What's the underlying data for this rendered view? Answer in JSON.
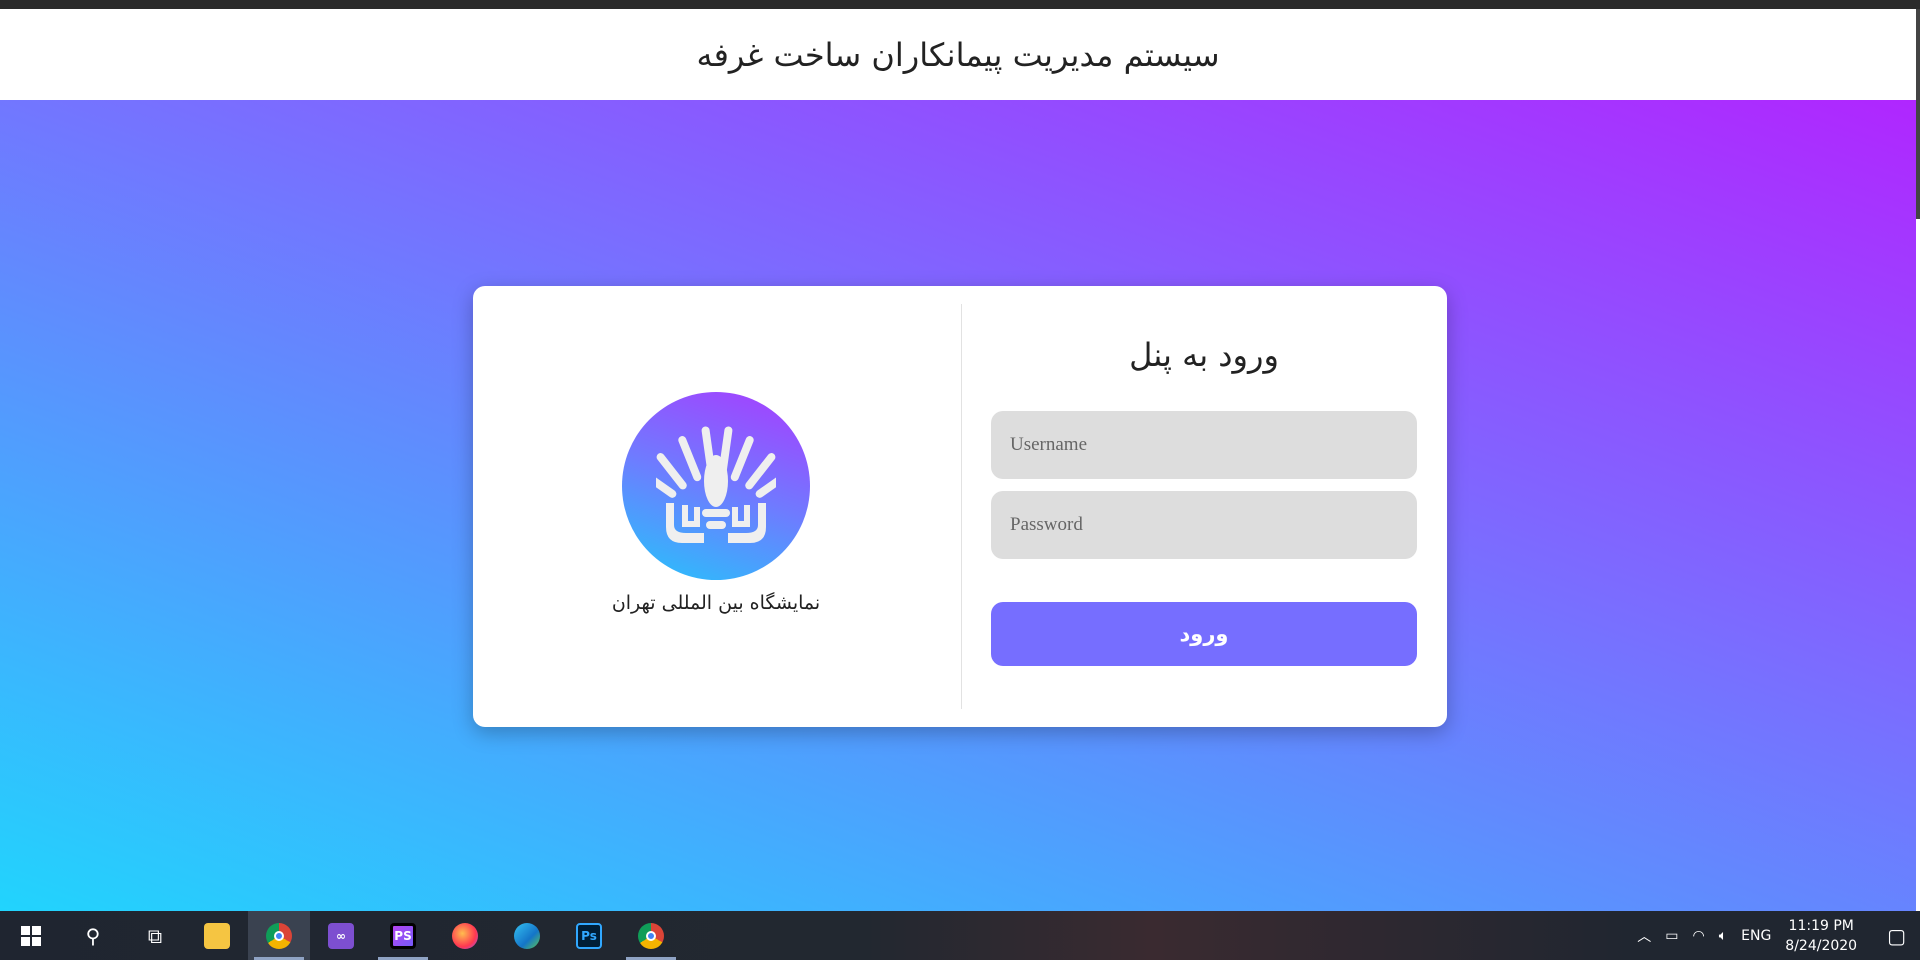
{
  "header": {
    "title": "سیستم مدیریت پیمانکاران ساخت غرفه"
  },
  "login": {
    "organization": "نمایشگاه بین المللی تهران",
    "title": "ورود به پنل",
    "username_placeholder": "Username",
    "password_placeholder": "Password",
    "submit_label": "ورود"
  },
  "taskbar": {
    "apps": [
      "start",
      "search",
      "task-view",
      "file-explorer",
      "chrome",
      "visual-studio",
      "phpstorm",
      "firefox",
      "edge",
      "photoshop",
      "chrome"
    ],
    "ps_label": "Ps",
    "phpstorm_label": "PS",
    "language": "ENG",
    "time": "11:19 PM",
    "date": "8/24/2020"
  },
  "colors": {
    "accent": "#766eff",
    "gradient_top": "#b026ff",
    "gradient_bottom": "#21d4fd"
  }
}
